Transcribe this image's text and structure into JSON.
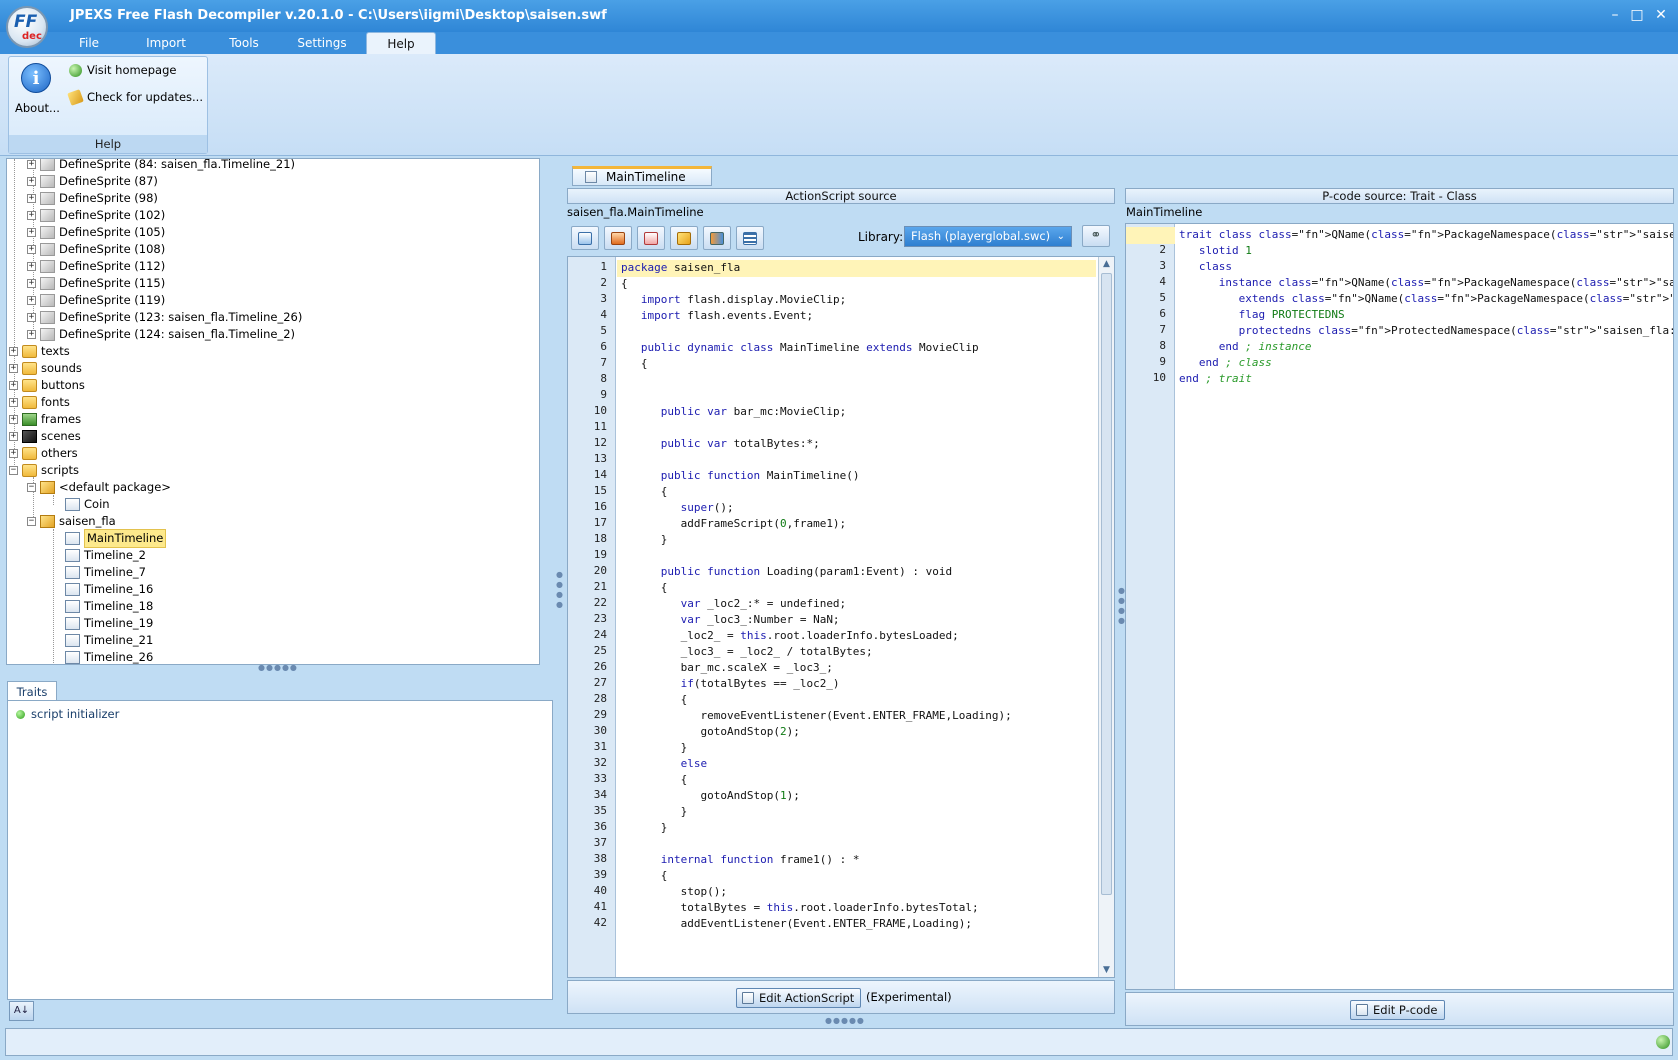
{
  "window": {
    "title": "JPEXS Free Flash Decompiler v.20.1.0 - C:\\Users\\iigmi\\Desktop\\saisen.swf",
    "logo_text": "FF",
    "logo_sub": "dec"
  },
  "menu": {
    "tabs": [
      "File",
      "Import",
      "Tools",
      "Settings",
      "Help"
    ],
    "active": "Help"
  },
  "ribbon": {
    "group_caption": "Help",
    "about_label": "About...",
    "visit_homepage": "Visit homepage",
    "check_updates": "Check for updates..."
  },
  "tree": {
    "sprites": [
      "DefineSprite (84: saisen_fla.Timeline_21)",
      "DefineSprite (87)",
      "DefineSprite (98)",
      "DefineSprite (102)",
      "DefineSprite (105)",
      "DefineSprite (108)",
      "DefineSprite (112)",
      "DefineSprite (115)",
      "DefineSprite (119)",
      "DefineSprite (123: saisen_fla.Timeline_26)",
      "DefineSprite (124: saisen_fla.Timeline_2)"
    ],
    "folders": [
      "texts",
      "sounds",
      "buttons",
      "fonts",
      "frames",
      "scenes",
      "others",
      "scripts"
    ],
    "default_package": "<default package>",
    "coin": "Coin",
    "saisen_package": "saisen_fla",
    "scripts": [
      "MainTimeline",
      "Timeline_2",
      "Timeline_7",
      "Timeline_16",
      "Timeline_18",
      "Timeline_19",
      "Timeline_21",
      "Timeline_26"
    ],
    "selected": "MainTimeline"
  },
  "traits": {
    "tab_label": "Traits",
    "items": [
      "script initializer"
    ]
  },
  "editor": {
    "doc_tab": "MainTimeline",
    "actionscript_header": "ActionScript source",
    "actionscript_path": "saisen_fla.MainTimeline",
    "library_label": "Library:",
    "library_value": "Flash (playerglobal.swc)",
    "edit_as_button": "Edit ActionScript",
    "experimental_note": "(Experimental)",
    "pcode_header": "P-code source: Trait - Class",
    "pcode_path": "MainTimeline",
    "edit_pcode_button": "Edit P-code"
  },
  "actionscript_lines": [
    "package saisen_fla",
    "{",
    "   import flash.display.MovieClip;",
    "   import flash.events.Event;",
    "",
    "   public dynamic class MainTimeline extends MovieClip",
    "   {",
    "",
    "",
    "      public var bar_mc:MovieClip;",
    "",
    "      public var totalBytes:*;",
    "",
    "      public function MainTimeline()",
    "      {",
    "         super();",
    "         addFrameScript(0,frame1);",
    "      }",
    "",
    "      public function Loading(param1:Event) : void",
    "      {",
    "         var _loc2_:* = undefined;",
    "         var _loc3_:Number = NaN;",
    "         _loc2_ = this.root.loaderInfo.bytesLoaded;",
    "         _loc3_ = _loc2_ / totalBytes;",
    "         bar_mc.scaleX = _loc3_;",
    "         if(totalBytes == _loc2_)",
    "         {",
    "            removeEventListener(Event.ENTER_FRAME,Loading);",
    "            gotoAndStop(2);",
    "         }",
    "         else",
    "         {",
    "            gotoAndStop(1);",
    "         }",
    "      }",
    "",
    "      internal function frame1() : *",
    "      {",
    "         stop();",
    "         totalBytes = this.root.loaderInfo.bytesTotal;",
    "         addEventListener(Event.ENTER_FRAME,Loading);"
  ],
  "pcode_lines": [
    "trait class QName(PackageNamespace(\"saisen_fla\"),\"MainTimeline\")",
    "   slotid 1",
    "   class",
    "      instance QName(PackageNamespace(\"saisen_fla\"),\"MainTimeline\")",
    "         extends QName(PackageNamespace(\"flash.display\"),\"MovieClip\")",
    "         flag PROTECTEDNS",
    "         protectedns ProtectedNamespace(\"saisen_fla:MainTimeline\")",
    "      end ; instance",
    "   end ; class",
    "end ; trait"
  ],
  "colors": {
    "titlebar": "#2f86d6",
    "selection": "#fde98c",
    "keyword": "#1c1cb0",
    "string": "#c2491d"
  }
}
